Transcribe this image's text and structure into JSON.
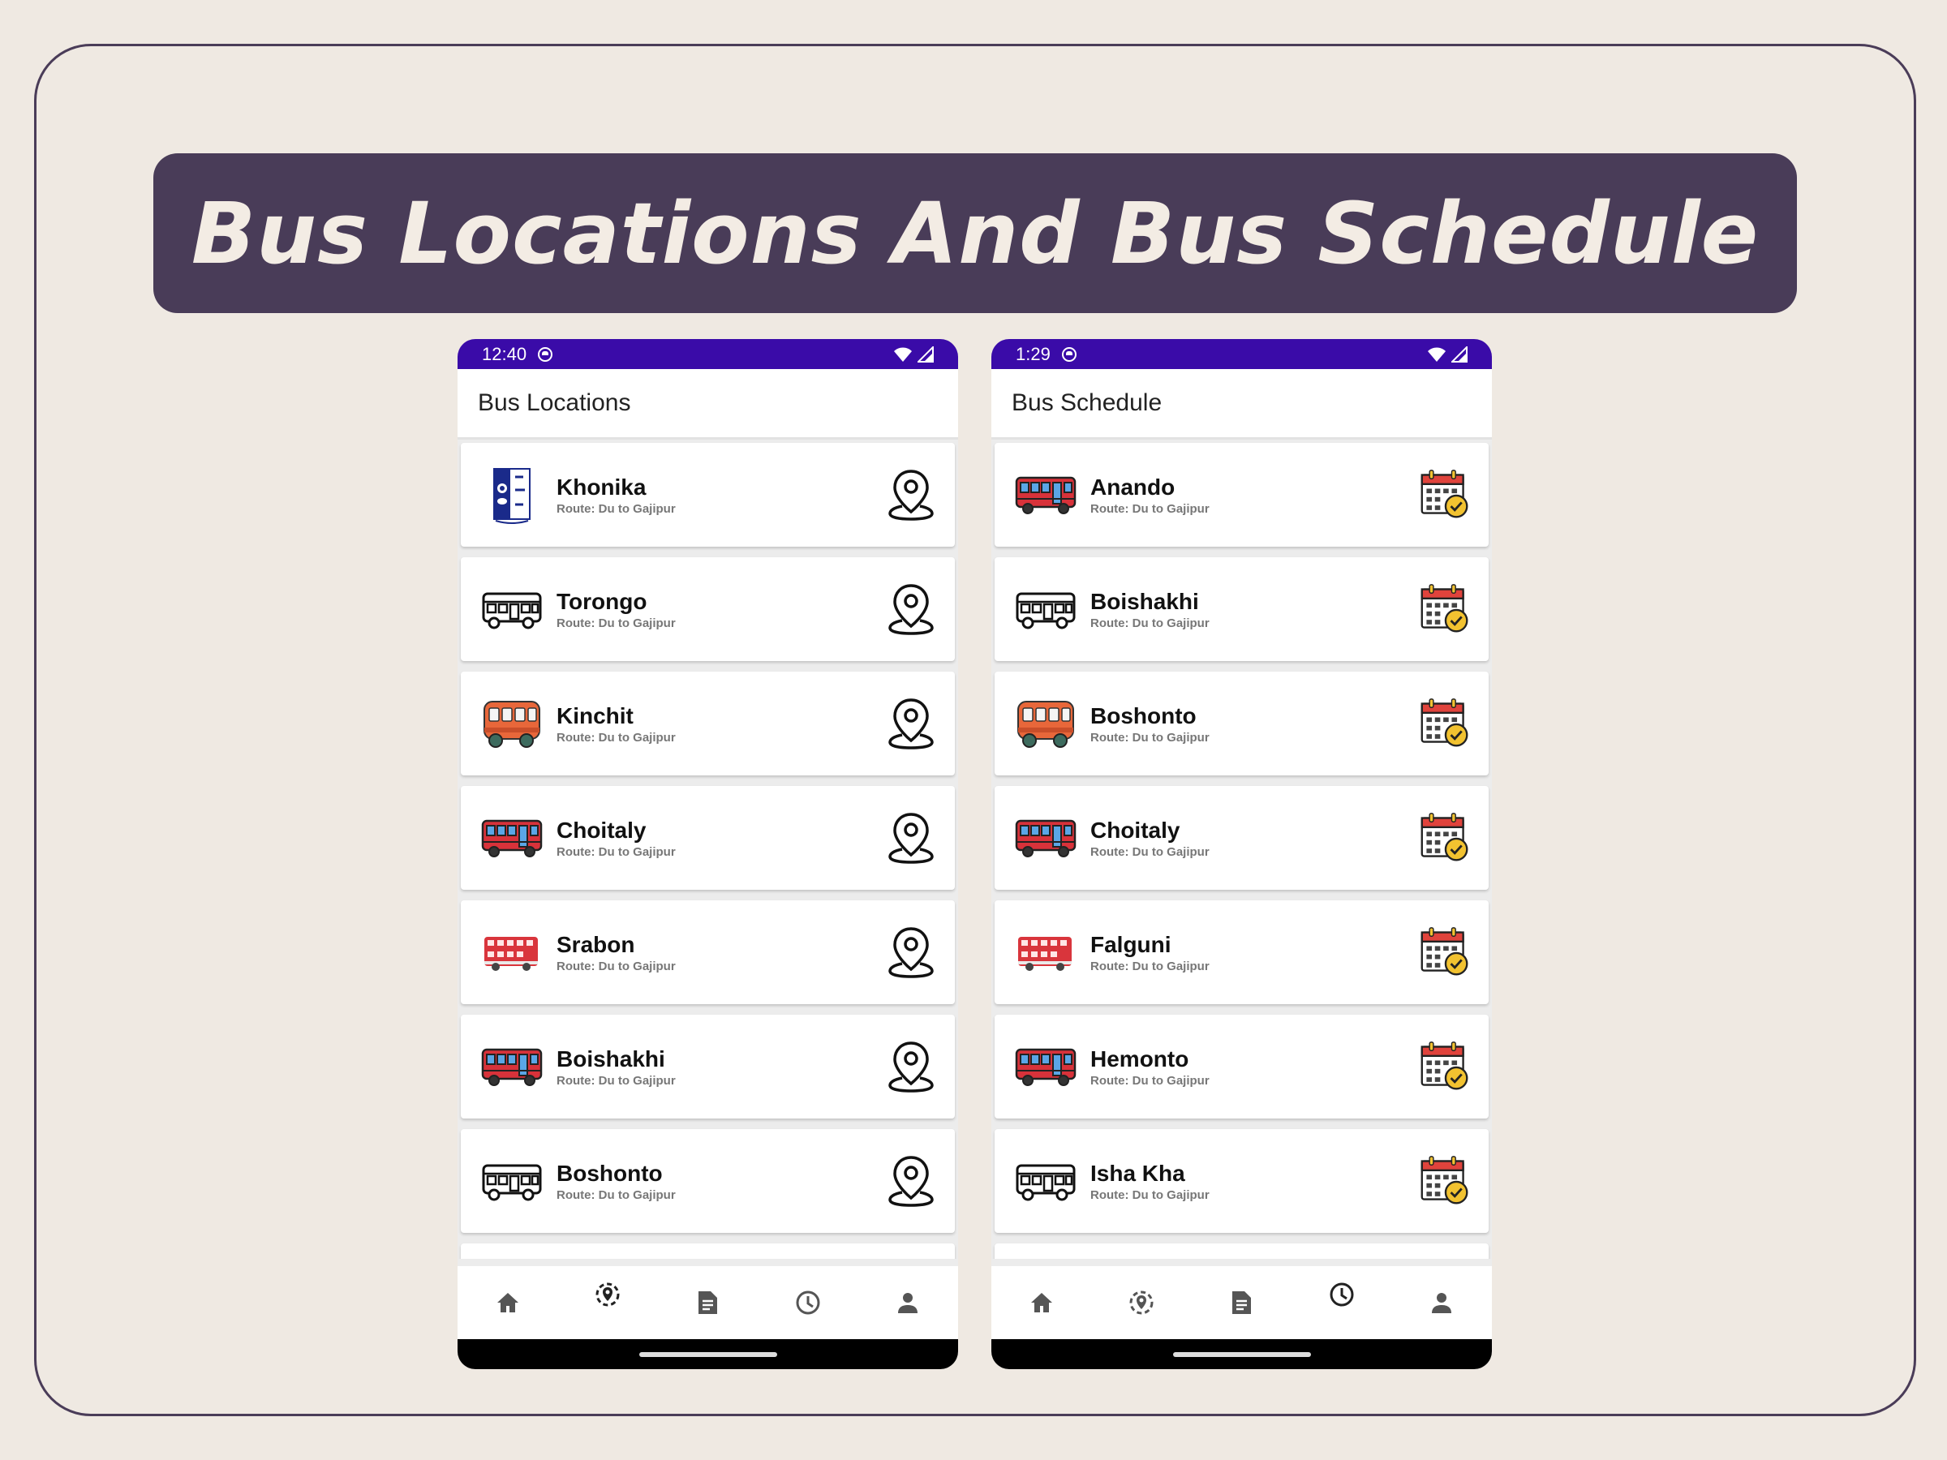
{
  "banner": {
    "title": "Bus Locations And Bus Schedule"
  },
  "left_screen": {
    "status_time": "12:40",
    "title": "Bus Locations",
    "items": [
      {
        "name": "Khonika",
        "route": "Route: Du to Gajipur",
        "icon": "logo-badge"
      },
      {
        "name": "Torongo",
        "route": "Route: Du to Gajipur",
        "icon": "bus-outline-icon"
      },
      {
        "name": "Kinchit",
        "route": "Route: Du to Gajipur",
        "icon": "bus-orange-icon"
      },
      {
        "name": "Choitaly",
        "route": "Route: Du to Gajipur",
        "icon": "bus-red-icon"
      },
      {
        "name": "Srabon",
        "route": "Route: Du to Gajipur",
        "icon": "bus-double-decker-icon"
      },
      {
        "name": "Boishakhi",
        "route": "Route: Du to Gajipur",
        "icon": "bus-red-icon"
      },
      {
        "name": "Boshonto",
        "route": "Route: Du to Gajipur",
        "icon": "bus-outline-icon"
      }
    ],
    "action_icon": "map-pin-icon",
    "active_tab": "location"
  },
  "right_screen": {
    "status_time": "1:29",
    "title": "Bus Schedule",
    "items": [
      {
        "name": "Anando",
        "route": "Route: Du to Gajipur",
        "icon": "bus-red-icon"
      },
      {
        "name": "Boishakhi",
        "route": "Route: Du to Gajipur",
        "icon": "bus-outline-icon"
      },
      {
        "name": "Boshonto",
        "route": "Route: Du to Gajipur",
        "icon": "bus-orange-icon"
      },
      {
        "name": "Choitaly",
        "route": "Route: Du to Gajipur",
        "icon": "bus-red-icon"
      },
      {
        "name": "Falguni",
        "route": "Route: Du to Gajipur",
        "icon": "bus-double-decker-icon"
      },
      {
        "name": "Hemonto",
        "route": "Route: Du to Gajipur",
        "icon": "bus-red-icon"
      },
      {
        "name": "Isha Kha",
        "route": "Route: Du to Gajipur",
        "icon": "bus-outline-icon"
      }
    ],
    "action_icon": "calendar-check-icon",
    "active_tab": "schedule"
  },
  "nav_tabs": [
    "home-icon",
    "location-icon",
    "notes-icon",
    "clock-icon",
    "profile-icon"
  ],
  "colors": {
    "background": "#efe9e2",
    "banner": "#493c58",
    "status_bar": "#3a0ba8",
    "bus_red": "#d8323a",
    "bus_orange": "#e8673a"
  }
}
